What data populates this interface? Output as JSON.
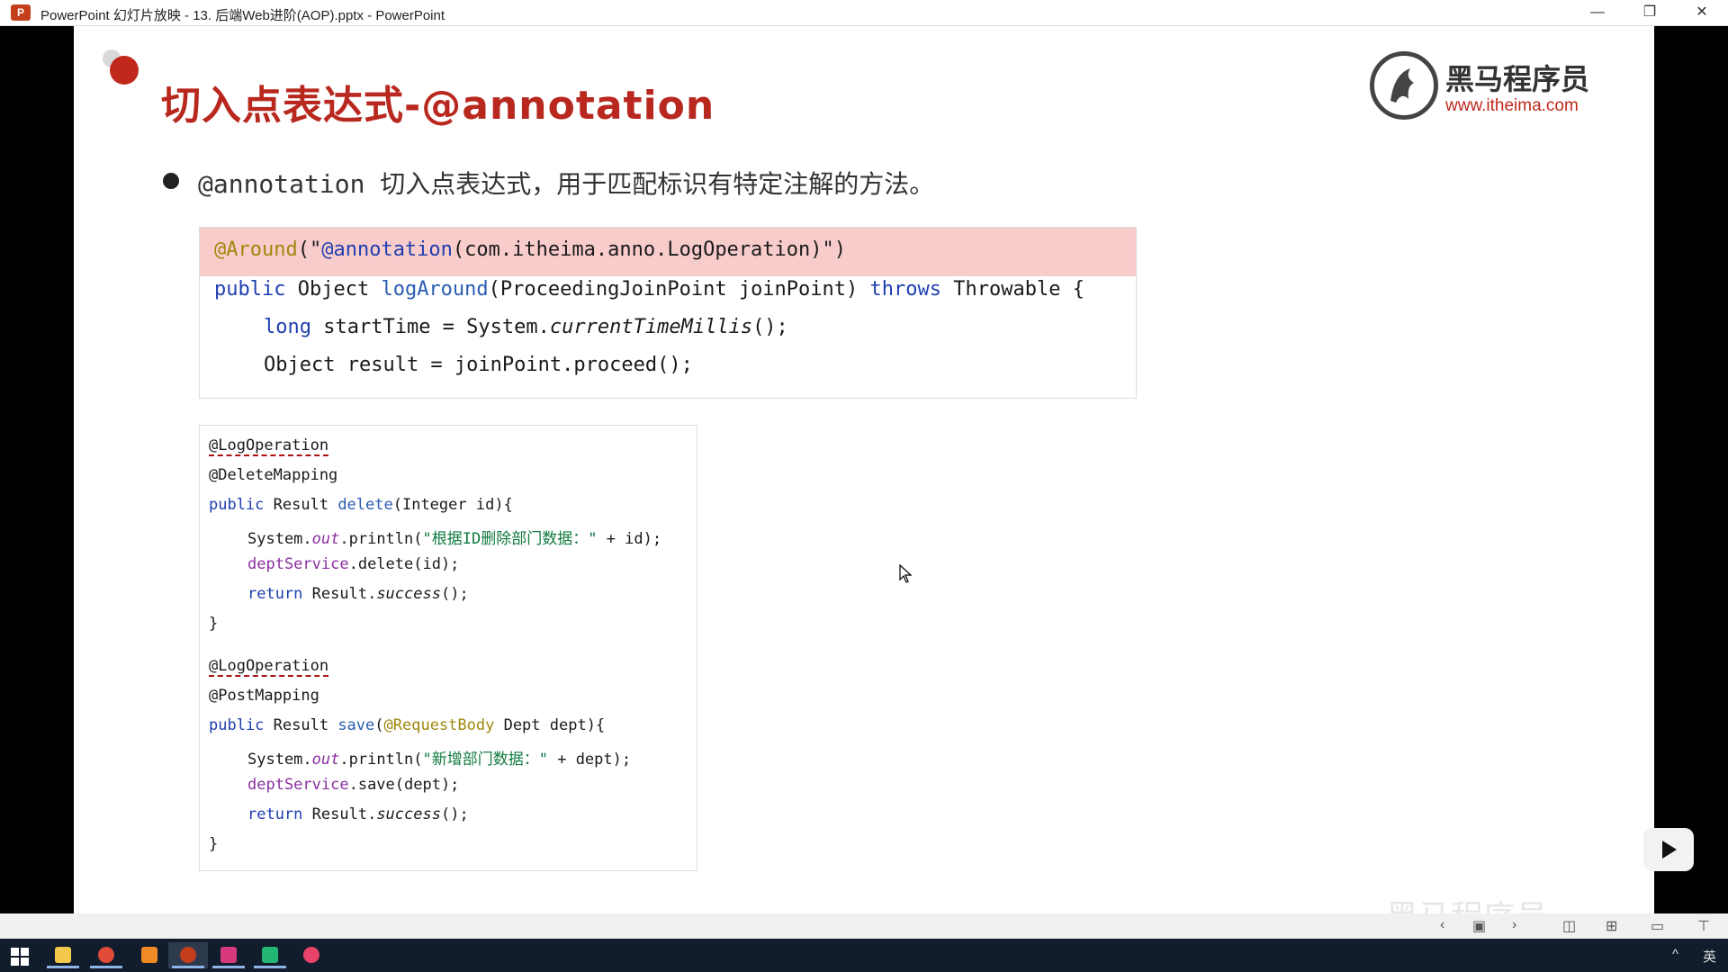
{
  "window": {
    "title": "PowerPoint 幻灯片放映  -  13. 后端Web进阶(AOP).pptx - PowerPoint",
    "controls": {
      "minimize": "—",
      "restore": "❐",
      "close": "✕"
    }
  },
  "slide": {
    "title": "切入点表达式-@annotation",
    "logo": {
      "name": "黑马程序员",
      "url": "www.itheima.com"
    },
    "bullet": "@annotation 切入点表达式，用于匹配标识有特定注解的方法。",
    "code_block_1": {
      "line1": {
        "ann": "@Around",
        "open": "(\"",
        "inner": "@annotation",
        "rest": "(com.itheima.anno.LogOperation)\")"
      },
      "line2": {
        "kw": "public",
        "type": " Object ",
        "fn": "logAround",
        "params": "(ProceedingJoinPoint joinPoint) ",
        "throws": "throws",
        "tail": " Throwable {"
      },
      "line3": {
        "kw": "long",
        "mid": " startTime = System.",
        "it": "currentTimeMillis",
        "tail": "();"
      },
      "line4": "Object result = joinPoint.proceed();"
    },
    "code_block_2": {
      "m1": {
        "ann1": "@LogOperation",
        "ann2": "@DeleteMapping",
        "sig_kw": "public",
        "sig_type": " Result ",
        "sig_fn": "delete",
        "sig_params": "(Integer id){",
        "print_pre": "System.",
        "print_out": "out",
        "print_mid": ".println(",
        "print_str": "\"根据ID删除部门数据：\"",
        "print_tail": " + id);",
        "svc_field": "deptService",
        "svc_tail": ".delete(id);",
        "ret_kw": "return",
        "ret_mid": " Result.",
        "ret_it": "success",
        "ret_tail": "();",
        "close": "}"
      },
      "m2": {
        "ann1": "@LogOperation",
        "ann2": "@PostMapping",
        "sig_kw": "public",
        "sig_type": " Result ",
        "sig_fn": "save",
        "sig_open": "(",
        "sig_ann": "@RequestBody",
        "sig_params": " Dept dept){",
        "print_pre": "System.",
        "print_out": "out",
        "print_mid": ".println(",
        "print_str": "\"新增部门数据：\"",
        "print_tail": " + dept);",
        "svc_field": "deptService",
        "svc_tail": ".save(dept);",
        "ret_kw": "return",
        "ret_mid": " Result.",
        "ret_it": "success",
        "ret_tail": "();",
        "close": "}"
      }
    },
    "watermark": "黑马程序员"
  },
  "slideshow_bar": {
    "icons": [
      "prev-icon",
      "normal-view-icon",
      "next-icon",
      "reading-view-icon",
      "slide-sorter-icon",
      "presenter-view-icon",
      "slideshow-icon"
    ]
  },
  "taskbar": {
    "apps": [
      "windows-start-icon",
      "file-explorer-icon",
      "chrome-icon",
      "sublime-icon",
      "powerpoint-icon",
      "intellij-icon",
      "datagrip-icon",
      "app-icon"
    ],
    "ime": "英",
    "tray_arrow": "^"
  },
  "colors": {
    "title_red": "#b8281e",
    "highlight_pink": "#f9cccc",
    "annotation": "#9e880d",
    "keyword": "#1f3fb0",
    "string": "#107a3f",
    "field": "#8a2f9e"
  }
}
